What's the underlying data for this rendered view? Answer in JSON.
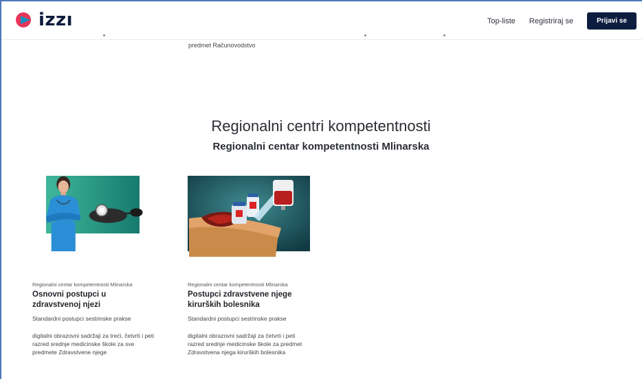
{
  "header": {
    "logo_text": "izzı",
    "nav": {
      "top_lists": "Top-liste",
      "register": "Registriraj se",
      "login": "Prijavi se"
    }
  },
  "previous": {
    "trailing_text": "predmet Računovodstvo"
  },
  "section": {
    "title": "Regionalni centri kompetentnosti",
    "subtitle": "Regionalni centar kompetentnosti Mlinarska"
  },
  "cards": [
    {
      "meta": "Regionalni centar kompetentnosti Mlinarska",
      "title": "Osnovni postupci u zdravstvenoj njezi",
      "subtitle": "Standardni postupci sestrinske prakse",
      "description": "digitalni obrazovni sadržaji za treći, četvrti i peti razred srednje medicinske škole za sve predmete Zdravstvene njege"
    },
    {
      "meta": "Regionalni centar kompetentnosti Mlinarska",
      "title": "Postupci zdravstvene njege kirurških bolesnika",
      "subtitle": "Standardni postupci sestrinske prakse",
      "description": "digitalni obrazovni sadržaji za četvrti i peti razred srednje medicinske škole za predmet Zdravstvena njega kirurških bolesnika"
    }
  ],
  "colors": {
    "brand_navy": "#0d1d3f",
    "logo_pink": "#e8355a",
    "logo_blue": "#1fb6e8",
    "teal": "#1d8f7f"
  }
}
